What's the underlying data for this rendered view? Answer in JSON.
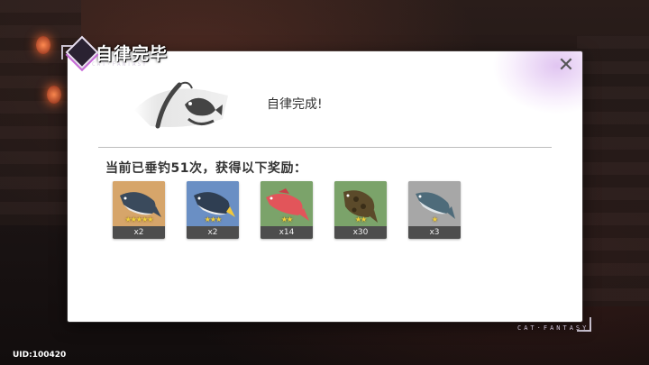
{
  "dialog": {
    "title": "自律完毕",
    "title_sub": "CAT·FANTASY",
    "close_symbol": "✕",
    "status_text": "自律完成!",
    "summary_text": "当前已垂钓51次，获得以下奖励："
  },
  "rewards": [
    {
      "name": "tuna",
      "stars": "★★★★★",
      "star_count": 5,
      "quantity": "x2",
      "bg": "#d6a56a"
    },
    {
      "name": "tuna-blue",
      "stars": "★★★",
      "star_count": 3,
      "quantity": "x2",
      "bg": "#6a8fc4"
    },
    {
      "name": "red-fish",
      "stars": "★★",
      "star_count": 2,
      "quantity": "x14",
      "bg": "#7ba36a"
    },
    {
      "name": "grouper",
      "stars": "★★",
      "star_count": 2,
      "quantity": "x30",
      "bg": "#7ba36a"
    },
    {
      "name": "silver-fish",
      "stars": "★",
      "star_count": 1,
      "quantity": "x3",
      "bg": "#a7a7a7"
    }
  ],
  "footer": {
    "brand": "CAT·FANTASY",
    "uid": "UID:100420"
  },
  "colors": {
    "panel_bg": "#ffffff",
    "star": "#f3d23c",
    "qty_bar": "#4d4d4d"
  }
}
